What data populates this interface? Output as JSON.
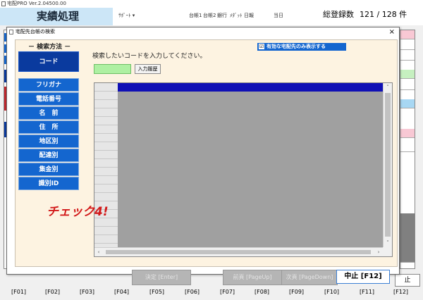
{
  "app": {
    "title": "宅配PRO  Ver.2.04500.00",
    "screen_title": "実績処理",
    "header_items": [
      "ｻﾎﾟｰﾄ ▾",
      "台帳1",
      "台帳2",
      "銀行",
      "ﾒﾀﾞｯﾄ",
      "日報",
      "当日"
    ],
    "count_label": "総登録数",
    "count_value": "121 / 128 件"
  },
  "dialog": {
    "title": "宅配先台帳の検索",
    "close": "×",
    "method_caption": "－ 検索方法 －",
    "methods": [
      "コード",
      "フリガナ",
      "電話番号",
      "名　前",
      "住　所",
      "地区別",
      "配達別",
      "集金別",
      "識別ID"
    ],
    "only_valid_label": "有効な宅配先のみ表示する",
    "only_valid_checked": "☑",
    "instruction": "検索したいコードを入力してください。",
    "code_input_value": "",
    "history_button": "入力履歴",
    "check_label": "チェック4!",
    "buttons": {
      "decide": "決定 [Enter]",
      "prev": "前頁 [PageUp]",
      "next": "次頁 [PageDown]",
      "stop": "中止 [F12]"
    }
  },
  "fkeys": [
    "[F01]",
    "[F02]",
    "[F03]",
    "[F04]",
    "[F05]",
    "[F06]",
    "[F07]",
    "[F08]",
    "[F09]",
    "[F10]",
    "[F11]",
    "[F12]"
  ],
  "outer_stop": "止",
  "colors": {
    "accent": "#1466cf",
    "active": "#0a3a9e",
    "grid_selected": "#1010b5",
    "check": "#d21a1a"
  }
}
